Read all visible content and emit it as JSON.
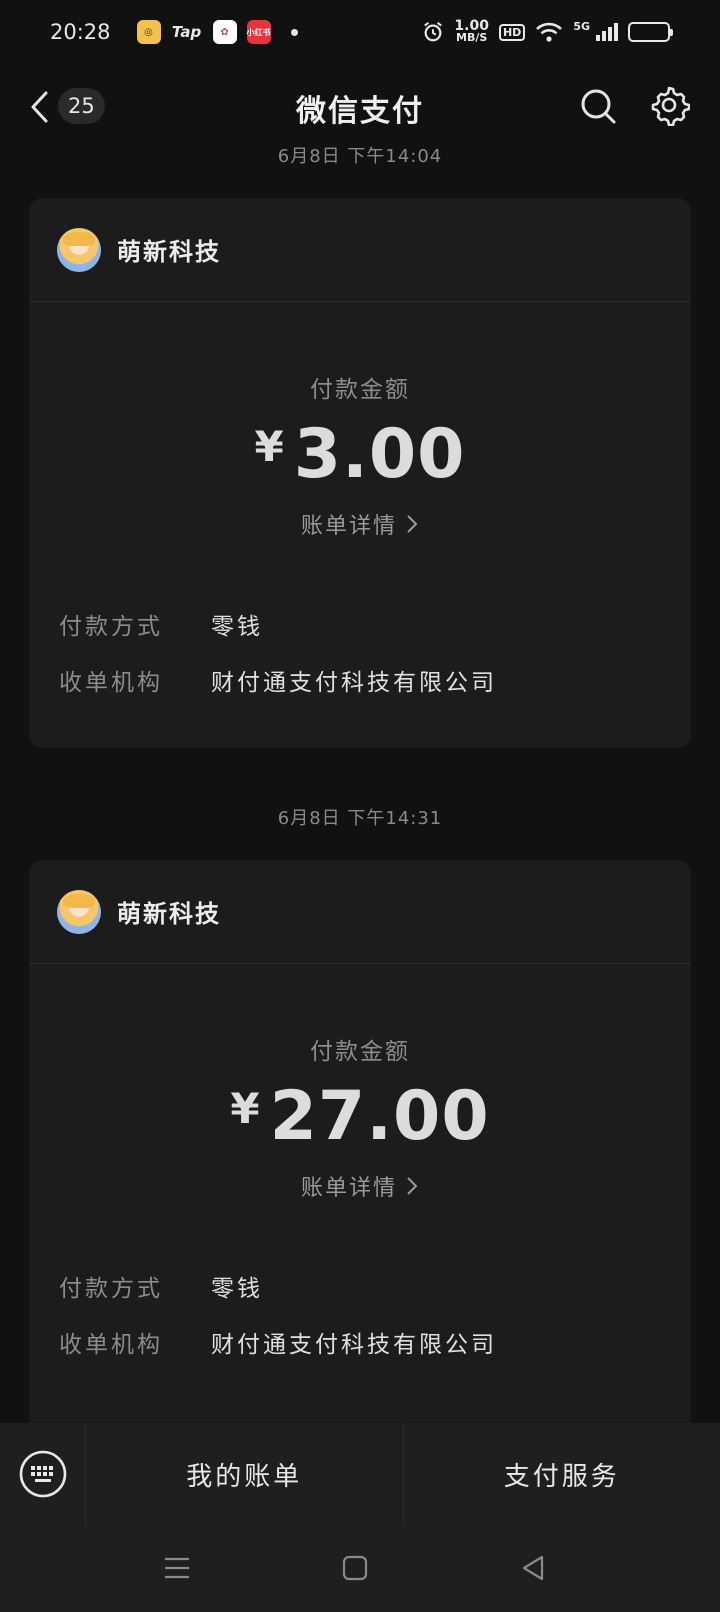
{
  "status_bar": {
    "time": "20:28",
    "apps": [
      "Tap"
    ],
    "app_badge_red": "小红书",
    "net_speed_value": "1.00",
    "net_speed_unit": "MB/S",
    "hd": "HD",
    "network": "5G"
  },
  "nav": {
    "back_count": "25",
    "title": "微信支付"
  },
  "messages": [
    {
      "timestamp": "6月8日 下午14:04",
      "merchant": "萌新科技",
      "amount_label": "付款金额",
      "currency": "¥",
      "amount": "3.00",
      "detail_label": "账单详情",
      "rows": [
        {
          "key": "付款方式",
          "value": "零钱"
        },
        {
          "key": "收单机构",
          "value": "财付通支付科技有限公司"
        }
      ]
    },
    {
      "timestamp": "6月8日 下午14:31",
      "merchant": "萌新科技",
      "amount_label": "付款金额",
      "currency": "¥",
      "amount": "27.00",
      "detail_label": "账单详情",
      "rows": [
        {
          "key": "付款方式",
          "value": "零钱"
        },
        {
          "key": "收单机构",
          "value": "财付通支付科技有限公司"
        }
      ]
    }
  ],
  "bottom_menu": {
    "my_bills": "我的账单",
    "pay_services": "支付服务"
  },
  "icons": {
    "back": "chevron-left-icon",
    "search": "search-icon",
    "settings": "gear-icon",
    "keyboard": "keyboard-icon"
  }
}
